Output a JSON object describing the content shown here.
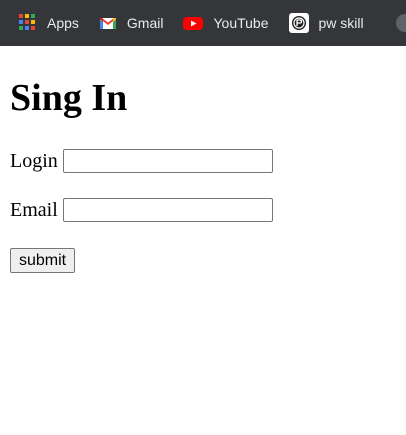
{
  "bookmarks": [
    {
      "label": "Apps",
      "icon": "apps-grid-icon"
    },
    {
      "label": "Gmail",
      "icon": "gmail-icon"
    },
    {
      "label": "YouTube",
      "icon": "youtube-icon"
    },
    {
      "label": "pw skill",
      "icon": "pw-skill-icon"
    }
  ],
  "colors": {
    "bookmarks_bar_bg": "#35363a",
    "bookmark_text": "#e8eaed",
    "youtube_red": "#ff0000",
    "gmail_red": "#ea4335"
  },
  "form": {
    "title": "Sing In",
    "login_label": "Login",
    "login_value": "",
    "email_label": "Email",
    "email_value": "",
    "submit_label": "submit"
  }
}
